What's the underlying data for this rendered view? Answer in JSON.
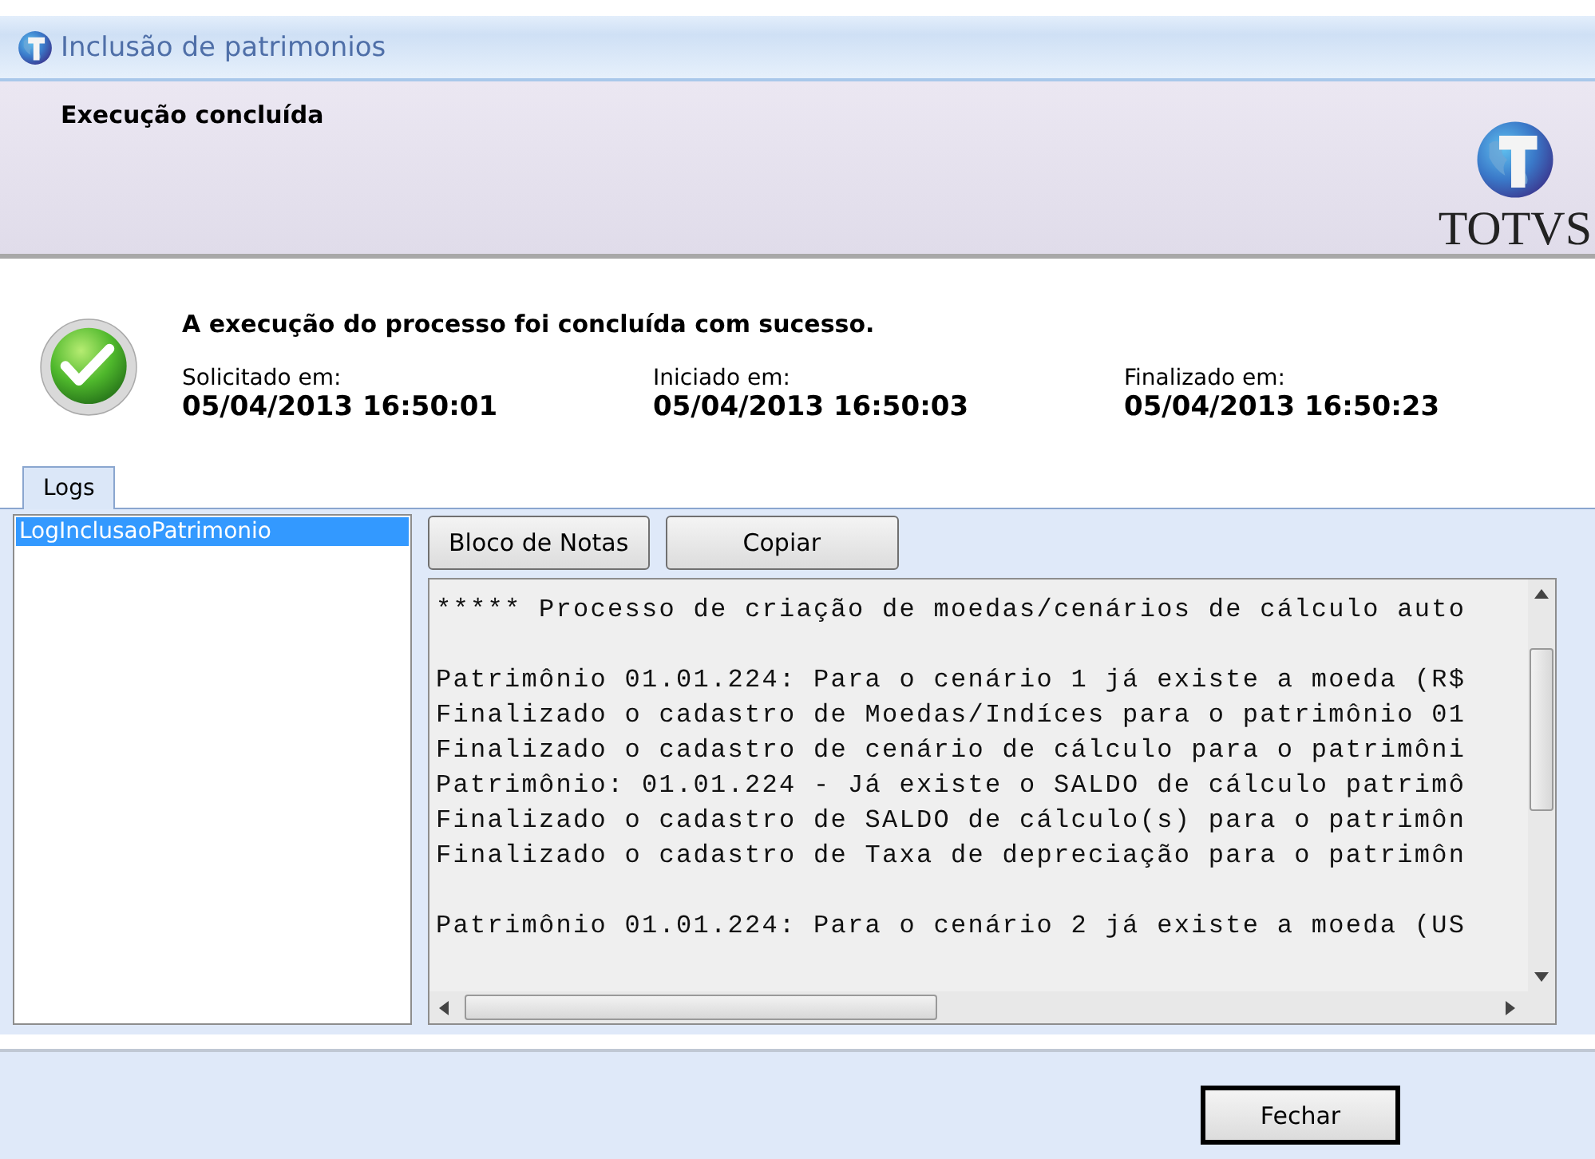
{
  "window": {
    "title": "Inclusão de patrimonios"
  },
  "header": {
    "title": "Execução concluída",
    "logo_text": "TOTVS"
  },
  "summary": {
    "message": "A execução do processo foi concluída com sucesso.",
    "times": [
      {
        "label": "Solicitado em:",
        "value": "05/04/2013 16:50:01"
      },
      {
        "label": "Iniciado em:",
        "value": "05/04/2013 16:50:03"
      },
      {
        "label": "Finalizado em:",
        "value": "05/04/2013 16:50:23"
      }
    ]
  },
  "tabs": [
    {
      "label": "Logs",
      "selected": true
    }
  ],
  "log_list": [
    {
      "label": "LogInclusaoPatrimonio",
      "selected": true
    }
  ],
  "log_buttons": [
    "Bloco de Notas",
    "Copiar"
  ],
  "log_paragraphs": [
    [
      "***** Processo de criação de moedas/cenários de cálculo auto"
    ],
    [
      "Patrimônio 01.01.224: Para o cenário 1 já existe a moeda (R$",
      "Finalizado o cadastro de Moedas/Indíces para o patrimônio 01",
      "Finalizado o cadastro de cenário de cálculo para o patrimôni",
      "Patrimônio: 01.01.224 - Já existe o SALDO de cálculo patrimô",
      "Finalizado o cadastro de SALDO de cálculo(s) para o patrimôn",
      "Finalizado o cadastro de Taxa de depreciação para o patrimôn"
    ],
    [
      "Patrimônio 01.01.224: Para o cenário 2 já existe a moeda (US"
    ]
  ],
  "buttons": [
    "Fechar"
  ]
}
